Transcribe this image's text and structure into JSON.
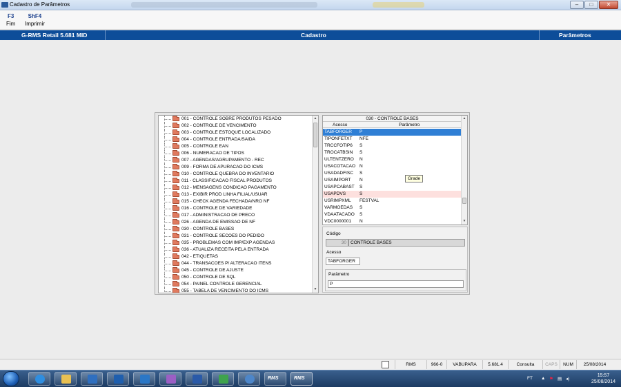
{
  "window": {
    "title": "Cadastro de Parâmetros",
    "btn_min": "–",
    "btn_max": "□",
    "btn_close": "✕"
  },
  "toolbar": [
    {
      "key": "F3",
      "label": "Fim"
    },
    {
      "key": "ShF4",
      "label": "Imprimir"
    }
  ],
  "header": {
    "left": "G-RMS Retail 5.681 MID",
    "center": "Cadastro",
    "right": "Parâmetros"
  },
  "tree": {
    "items": [
      "001 - CONTROLE SOBRE PRODUTOS PESADO",
      "002 - CONTROLE DE VENCIMENTO",
      "003 - CONTROLE ESTOQUE LOCALIZADO",
      "004 - CONTROLE ENTRADA/SAIDA",
      "005 - CONTROLE EAN",
      "006 - NUMERACAO DE TIPOS",
      "007 - AGENDAS/AGRUPAMENTO - REC",
      "009 - FORMA DE APURACAO DO ICMS",
      "010 - CONTROLE QUEBRA DO INVENTARIO",
      "011 - CLASSIFICACAO FISCAL PRODUTOS",
      "012 - MENSAGENS CONDICAO PAGAMENTO",
      "013 - EXIBIR PROD LINHA FILIAL/USUAR",
      "015 - CHECK AGENDA FECHADA/NRO NF",
      "016 - CONTROLE DE VARIEDADE",
      "017 - ADMINISTRACAO DE PRECO",
      "026 - AGENDA DE EMISSAO DE NF",
      "030 - CONTROLE BASES",
      "031 - CONTROLE SECOES DO PEDIDO",
      "035 - PROBLEMAS COM IMP/EXP AGENDAS",
      "036 - ATUALIZA RECEITA PELA ENTRADA",
      "042 - ETIQUETAS",
      "044 - TRANSACOES P/ ALTERACAO ITENS",
      "045 - CONTROLE DE AJUSTE",
      "050 - CONTROLE DE SQL",
      "054 - PAINEL CONTROLE GERENCIAL",
      "055 - TABELA DE VENCIMENTO DO ICMS"
    ]
  },
  "grid": {
    "title": "030 - CONTROLE BASES",
    "col_acesso": "Acesso",
    "col_parametro": "Parâmetro",
    "rows": [
      {
        "acesso": "TABFORGER",
        "parametro": "P",
        "state": "selected"
      },
      {
        "acesso": "TIPONFETXT",
        "parametro": "NFE",
        "state": ""
      },
      {
        "acesso": "TRCCFOTIP6",
        "parametro": "S",
        "state": ""
      },
      {
        "acesso": "TROCATBSIN",
        "parametro": "S",
        "state": ""
      },
      {
        "acesso": "ULTENTZERO",
        "parametro": "N",
        "state": ""
      },
      {
        "acesso": "USACOTACAO",
        "parametro": "N",
        "state": ""
      },
      {
        "acesso": "USADADFISC",
        "parametro": "S",
        "state": ""
      },
      {
        "acesso": "USAIMPORT",
        "parametro": "N",
        "state": ""
      },
      {
        "acesso": "USAPCABAST",
        "parametro": "S",
        "state": ""
      },
      {
        "acesso": "USAPDVS",
        "parametro": "S",
        "state": "hl"
      },
      {
        "acesso": "USRIMPXML",
        "parametro": "FESTVAL",
        "state": ""
      },
      {
        "acesso": "VARMOEDAS",
        "parametro": "S",
        "state": ""
      },
      {
        "acesso": "VDAATACADO",
        "parametro": "S",
        "state": ""
      },
      {
        "acesso": "VDC0000001",
        "parametro": "N",
        "state": ""
      }
    ],
    "tooltip": "Grade"
  },
  "detail": {
    "codigo_label": "Código",
    "codigo_num": "30",
    "codigo_desc": "CONTROLE BASES",
    "acesso_label": "Acesso",
    "acesso_value": "TABFORGER",
    "parametro_label": "Parâmetro",
    "parametro_value": "P"
  },
  "status": {
    "app": "RMS",
    "code": "966-0",
    "store": "VABUPARA",
    "version": "5.681.4",
    "mode": "Consulta",
    "caps": "CAPS",
    "num": "NUM",
    "date": "25/08/2014"
  },
  "taskbar": {
    "rms1": "RMS",
    "rms2": "RMS",
    "lang": "FT",
    "time": "15:57",
    "date": "25/08/2014"
  }
}
